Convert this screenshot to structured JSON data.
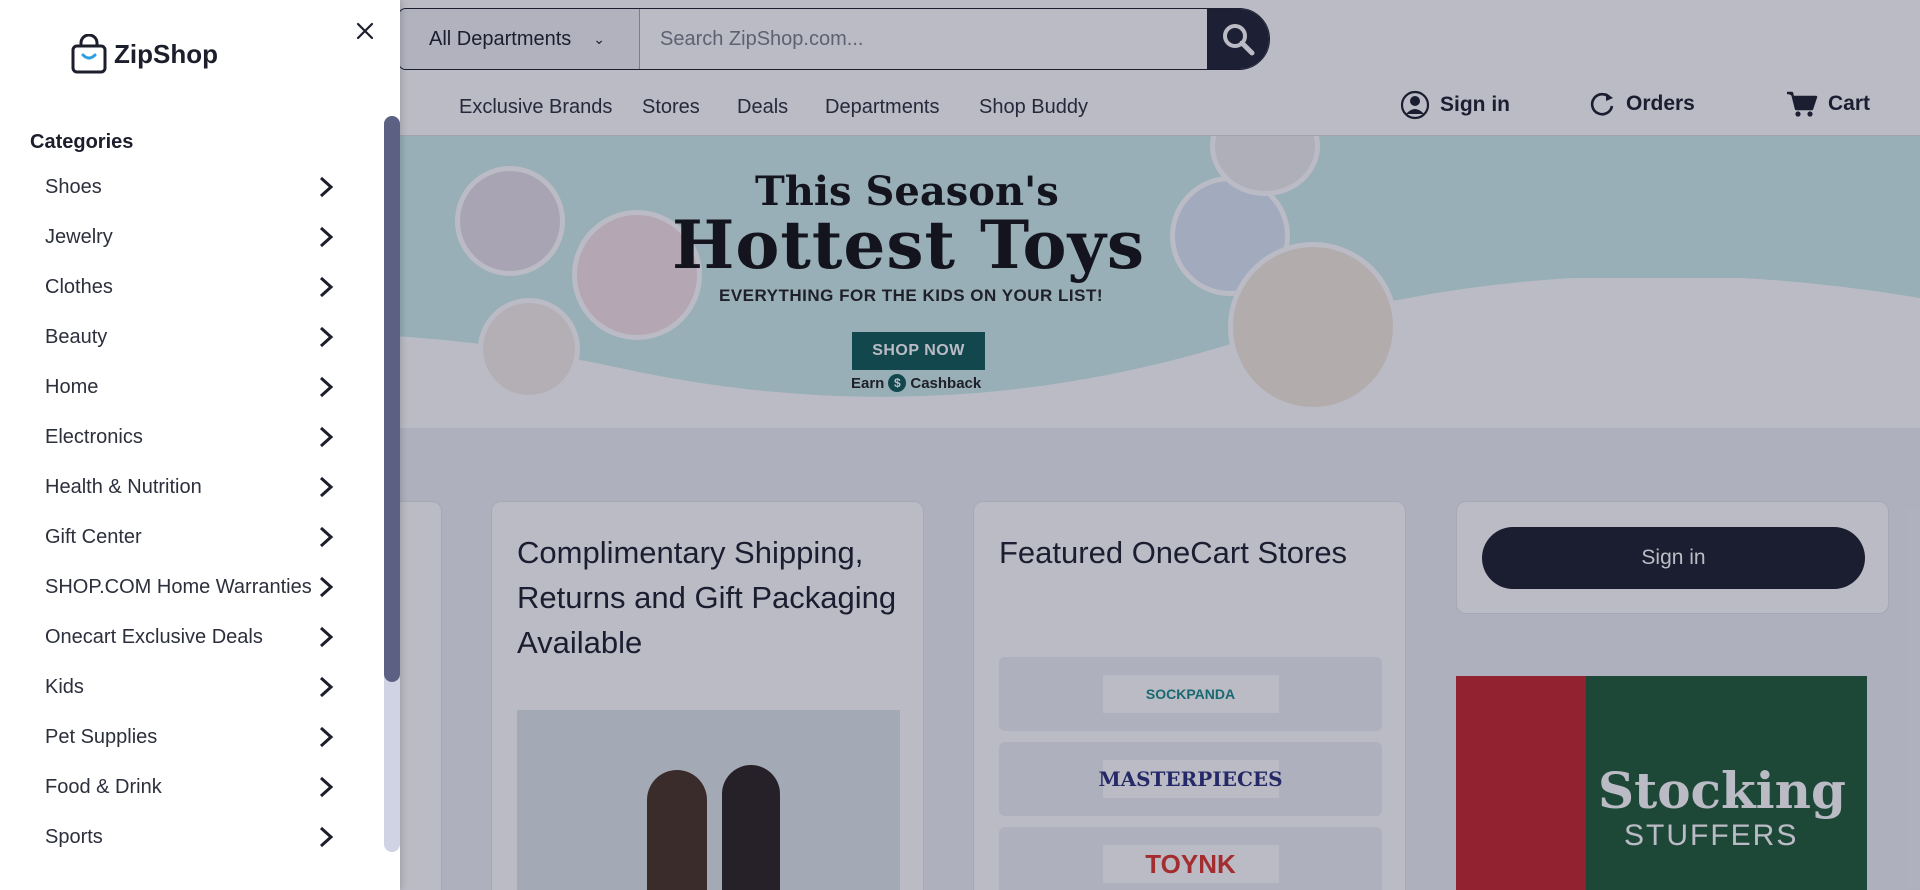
{
  "header": {
    "department_select": "All Departments",
    "search_placeholder": "Search ZipShop.com..."
  },
  "nav": {
    "links": [
      "Exclusive Brands",
      "Stores",
      "Deals",
      "Departments",
      "Shop Buddy"
    ],
    "sign_in": "Sign in",
    "orders": "Orders",
    "cart": "Cart"
  },
  "hero": {
    "title_line1": "This Season's",
    "title_line2": "Hottest Toys",
    "subtitle": "EVERYTHING FOR THE KIDS ON YOUR LIST!",
    "button": "SHOP NOW",
    "earn": "Earn",
    "cashback": "Cashback"
  },
  "cards": {
    "shipping_title": "Complimentary Shipping, Returns and Gift Packaging Available",
    "featured_title": "Featured OneCart Stores",
    "stores": [
      "SOCKPANDA",
      "MASTERPIECES",
      "TOYNK"
    ],
    "sign_in_button": "Sign in",
    "stocking_line1": "Stocking",
    "stocking_line2": "STUFFERS"
  },
  "drawer": {
    "logo_text": "ZipShop",
    "categories_heading": "Categories",
    "categories": [
      "Shoes",
      "Jewelry",
      "Clothes",
      "Beauty",
      "Home",
      "Electronics",
      "Health & Nutrition",
      "Gift Center",
      "SHOP.COM Home Warranties",
      "Onecart Exclusive Deals",
      "Kids",
      "Pet Supplies",
      "Food & Drink",
      "Sports"
    ]
  },
  "colors": {
    "brand_dark": "#1c1e2c",
    "accent_teal": "#0f5a55",
    "scrollbar_thumb": "#5c6184"
  }
}
